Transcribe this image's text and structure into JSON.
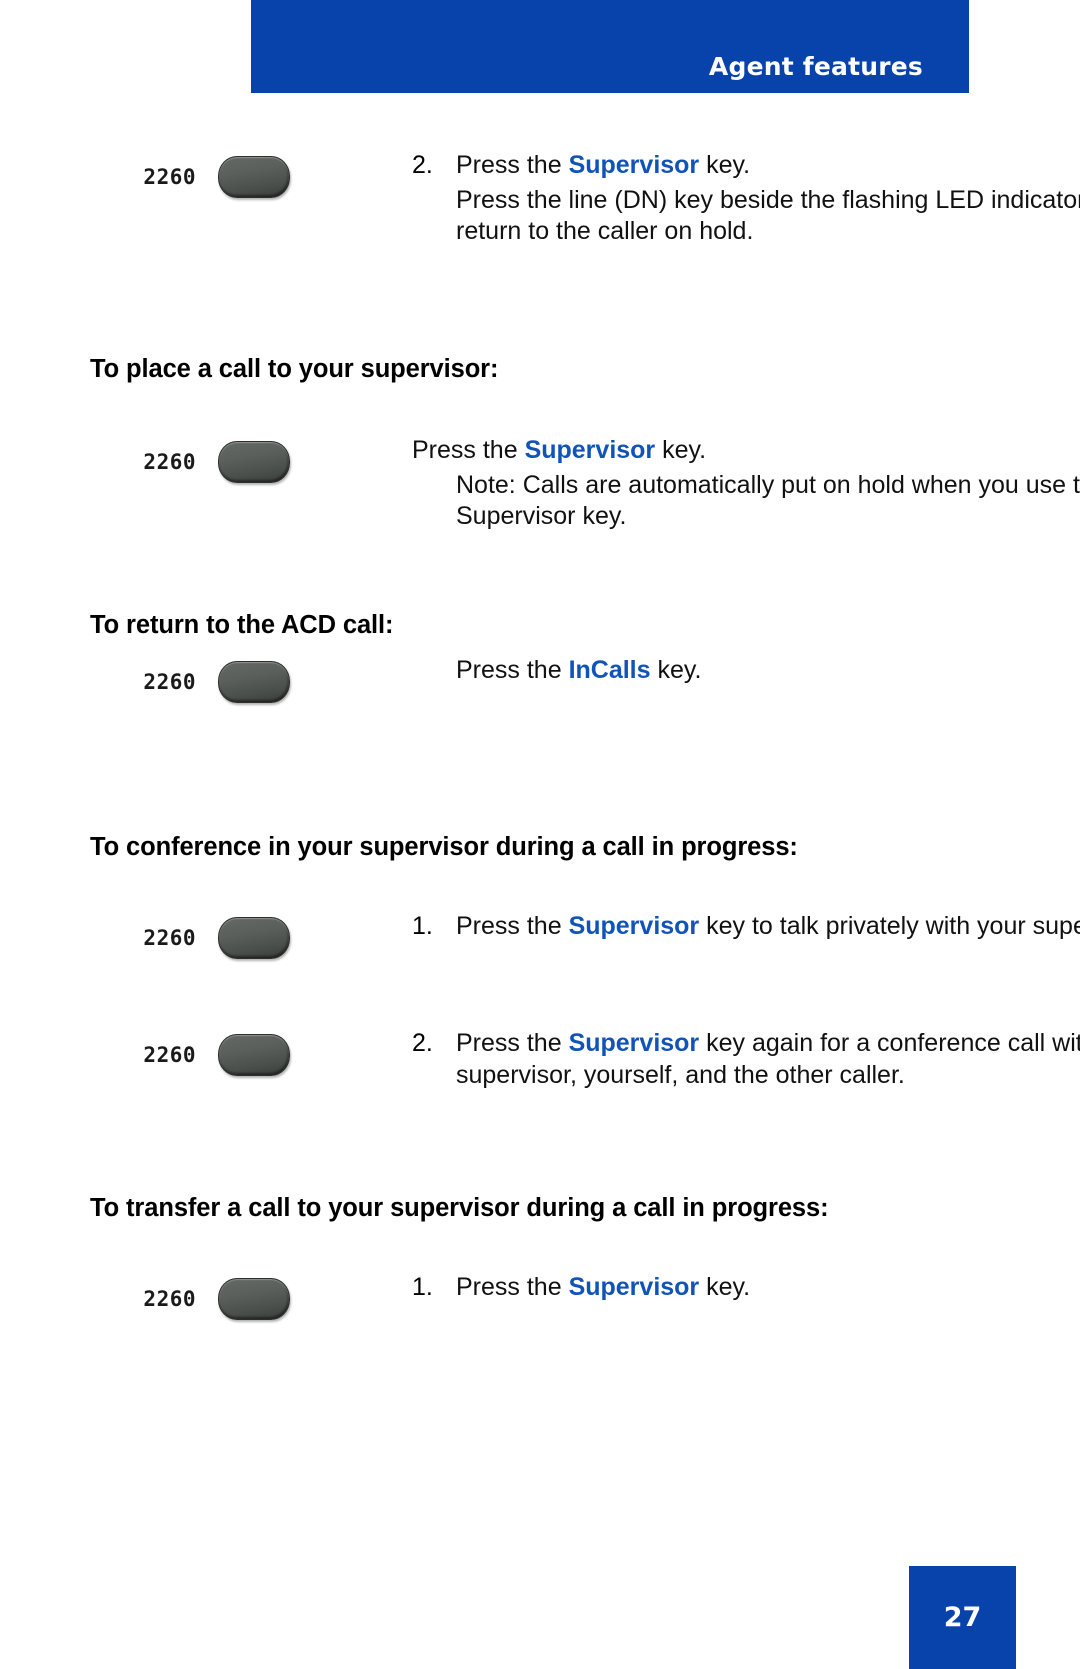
{
  "header": {
    "title": "Agent features",
    "background_color": "#0842ab",
    "text_color": "#ffffff"
  },
  "accent_color": "#1154b8",
  "key_icon_name": "phone-feature-key",
  "dn_label": "2260",
  "blocks": [
    {
      "type": "step",
      "id": "return-to-caller-on-hold",
      "dn_label": "2260",
      "number": "2.",
      "lines": [
        {
          "segments": [
            {
              "text": "Press the ",
              "style": "normal"
            },
            {
              "text": "Supervisor",
              "style": "keyword"
            },
            {
              "text": " key.",
              "style": "normal"
            }
          ],
          "indent": false
        },
        {
          "segments": [
            {
              "text": "Press the line (DN) key beside the flashing LED indicator to return to the caller on hold.",
              "style": "normal"
            }
          ],
          "indent": false
        }
      ]
    },
    {
      "type": "heading",
      "id": "place-call-to-supervisor",
      "text": "To place a call to your supervisor:"
    },
    {
      "type": "step",
      "id": "place-call-step",
      "dn_label": "2260",
      "number": "",
      "lines": [
        {
          "segments": [
            {
              "text": "Press the ",
              "style": "normal"
            },
            {
              "text": "Supervisor",
              "style": "keyword"
            },
            {
              "text": " key.",
              "style": "normal"
            }
          ],
          "indent": false
        },
        {
          "segments": [
            {
              "text": "Note: Calls are automatically put on hold when you use the Supervisor key.",
              "style": "normal"
            }
          ],
          "indent": true
        }
      ]
    },
    {
      "type": "heading",
      "id": "return-to-acd-call",
      "text": "To return to the ACD call:"
    },
    {
      "type": "step",
      "id": "return-acd-step",
      "dn_label": "2260",
      "number": "",
      "lines": [
        {
          "segments": [
            {
              "text": "Press the ",
              "style": "normal"
            },
            {
              "text": "InCalls",
              "style": "keyword"
            },
            {
              "text": " key.",
              "style": "normal"
            }
          ],
          "indent": true
        }
      ]
    },
    {
      "type": "heading",
      "id": "conference-in-supervisor",
      "text": "To conference in your supervisor during a call in progress:"
    },
    {
      "type": "step",
      "id": "conference-step-1",
      "dn_label": "2260",
      "number": "1.",
      "lines": [
        {
          "segments": [
            {
              "text": "Press the ",
              "style": "normal"
            },
            {
              "text": "Supervisor",
              "style": "keyword"
            },
            {
              "text": " key to talk privately with your supervisor.",
              "style": "normal"
            }
          ],
          "indent": false
        }
      ]
    },
    {
      "type": "step",
      "id": "conference-step-2",
      "dn_label": "2260",
      "number": "2.",
      "lines": [
        {
          "segments": [
            {
              "text": "Press the ",
              "style": "normal"
            },
            {
              "text": "Supervisor",
              "style": "keyword"
            },
            {
              "text": " key again for a conference call with your supervisor, yourself, and the other caller.",
              "style": "normal"
            }
          ],
          "indent": false
        }
      ]
    },
    {
      "type": "heading",
      "id": "transfer-call-to-supervisor",
      "text": "To transfer a call to your supervisor during a call in progress:"
    },
    {
      "type": "step",
      "id": "transfer-step-1",
      "dn_label": "2260",
      "number": "1.",
      "lines": [
        {
          "segments": [
            {
              "text": "Press the ",
              "style": "normal"
            },
            {
              "text": "Supervisor",
              "style": "keyword"
            },
            {
              "text": " key.",
              "style": "normal"
            }
          ],
          "indent": false
        }
      ]
    }
  ],
  "footer": {
    "page_number": "27",
    "background_color": "#0842ab",
    "text_color": "#ffffff"
  }
}
